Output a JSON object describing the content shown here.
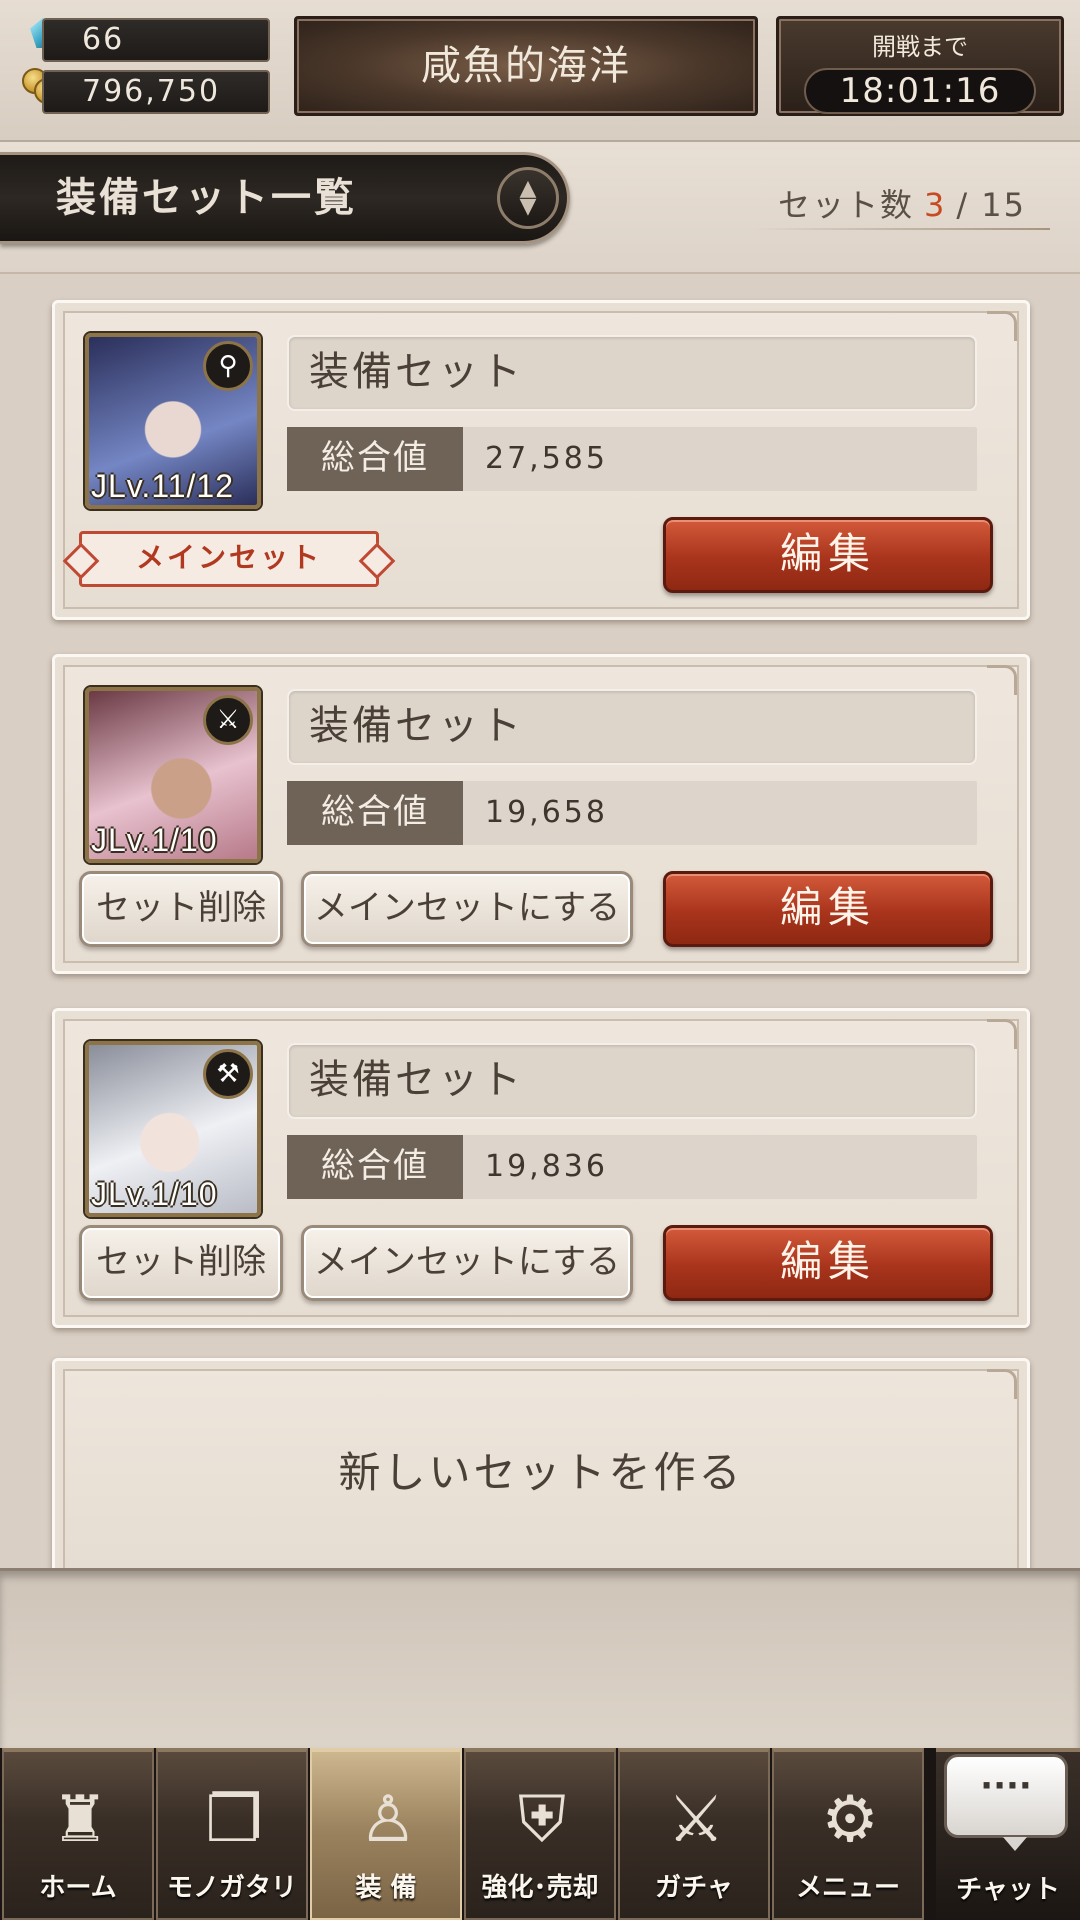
{
  "topbar": {
    "crystals": "66",
    "coins": "796,750",
    "guild_name": "咸魚的海洋",
    "battle_label": "開戦まで",
    "battle_timer": "18:01:16"
  },
  "section": {
    "title": "装備セット一覧",
    "sort_icon": "◇",
    "count_label": "セット数",
    "count_current": "3",
    "count_sep": "/",
    "count_max": "15"
  },
  "sets": [
    {
      "name": "装備セット",
      "total_label": "総合値",
      "total_value": "27,585",
      "level": "JLv.11/12",
      "weapon_icon": "staff-icon",
      "is_main": true,
      "main_badge": "メインセット",
      "edit_label": "編集",
      "portrait_colors": [
        "#2b2f5a",
        "#7486c4"
      ]
    },
    {
      "name": "装備セット",
      "total_label": "総合値",
      "total_value": "19,658",
      "level": "JLv.1/10",
      "weapon_icon": "sword-icon",
      "is_main": false,
      "delete_label": "セット削除",
      "make_main_label": "メインセットにする",
      "edit_label": "編集",
      "portrait_colors": [
        "#b77a8a",
        "#e8c2cf"
      ]
    },
    {
      "name": "装備セット",
      "total_label": "総合値",
      "total_value": "19,836",
      "level": "JLv.1/10",
      "weapon_icon": "hammer-icon",
      "is_main": false,
      "delete_label": "セット削除",
      "make_main_label": "メインセットにする",
      "edit_label": "編集",
      "portrait_colors": [
        "#b9bcc6",
        "#eef0f4"
      ]
    }
  ],
  "new_set_label": "新しいセットを作る",
  "nav": {
    "items": [
      {
        "label": "ホーム",
        "icon": "castle-icon"
      },
      {
        "label": "モノガタリ",
        "icon": "book-icon"
      },
      {
        "label": "装 備",
        "icon": "puppet-icon",
        "active": true
      },
      {
        "label": "強化･売却",
        "icon": "shield-icon"
      },
      {
        "label": "ガチャ",
        "icon": "swords-icon"
      },
      {
        "label": "メニュー",
        "icon": "gears-icon"
      }
    ],
    "chat_label": "チャット",
    "chat_bubble": "····"
  },
  "colors": {
    "accent_red": "#a9341c",
    "count_highlight": "#c84a22"
  }
}
